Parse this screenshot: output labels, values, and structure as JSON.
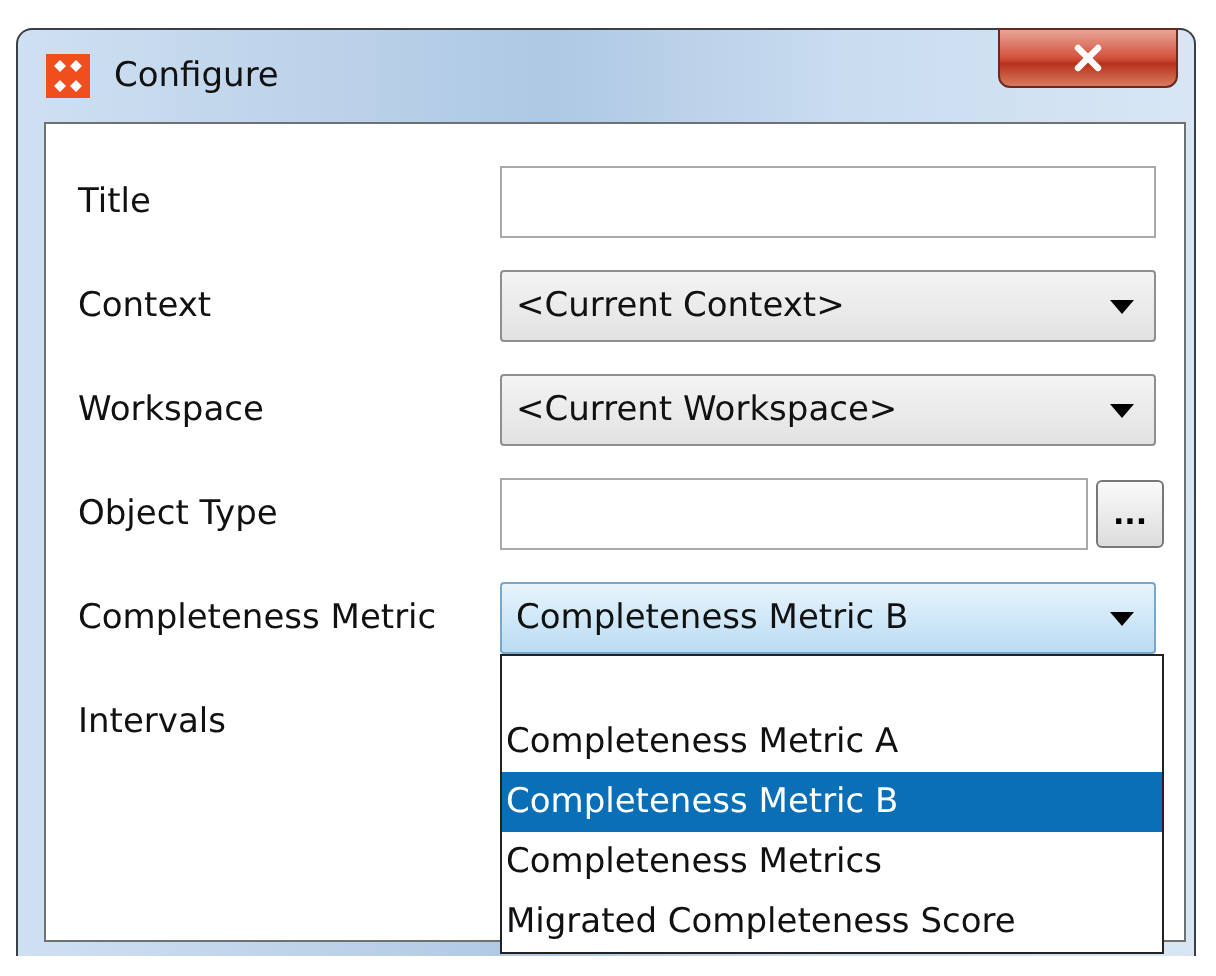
{
  "window": {
    "title": "Configure"
  },
  "fields": [
    {
      "label": "Title",
      "kind": "text"
    },
    {
      "label": "Context",
      "kind": "select",
      "value": "<Current Context>",
      "open": false
    },
    {
      "label": "Workspace",
      "kind": "select",
      "value": "<Current Workspace>",
      "open": false
    },
    {
      "label": "Object Type",
      "kind": "picker",
      "button": "..."
    },
    {
      "label": "Completeness Metric",
      "kind": "select",
      "value": "Completeness Metric B",
      "open": true
    },
    {
      "label": "Intervals",
      "kind": "none"
    }
  ],
  "dropdown_options": [
    {
      "label": "Completeness Metric A",
      "selected": false
    },
    {
      "label": "Completeness Metric B",
      "selected": true
    },
    {
      "label": "Completeness Metrics",
      "selected": false
    },
    {
      "label": "Migrated Completeness Score",
      "selected": false
    }
  ]
}
